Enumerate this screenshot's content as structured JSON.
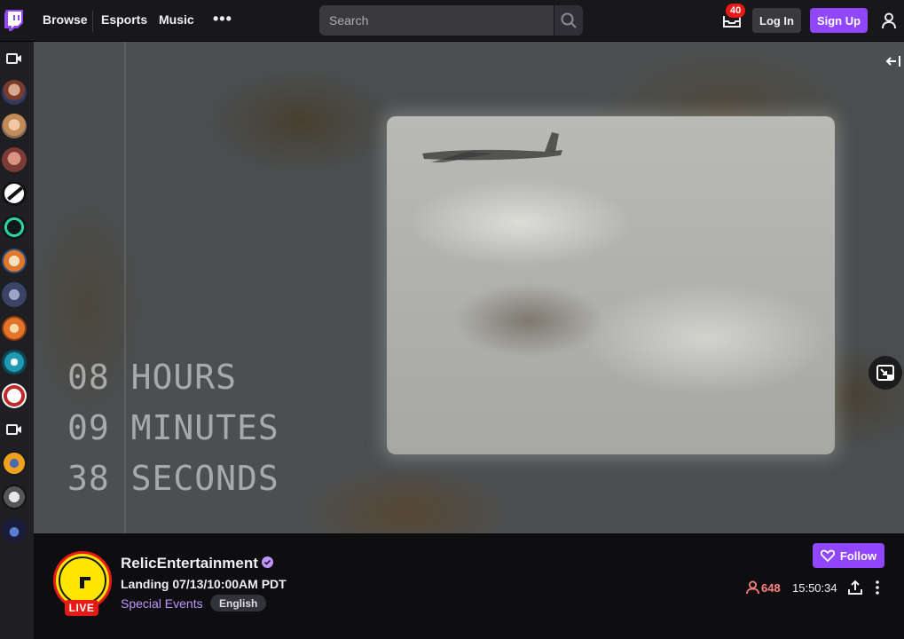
{
  "nav": {
    "links": [
      "Browse",
      "Esports",
      "Music"
    ],
    "more": "•••",
    "search_placeholder": "Search",
    "notification_count": "40",
    "login_label": "Log In",
    "signup_label": "Sign Up"
  },
  "player": {
    "countdown": [
      "08 HOURS",
      "09 MINUTES",
      "38 SECONDS"
    ]
  },
  "channel": {
    "name": "RelicEntertainment",
    "live_label": "LIVE",
    "stream_title": "Landing 07/13/10:00AM PDT",
    "category": "Special Events",
    "tag": "English",
    "follow_label": "Follow",
    "viewers": "648",
    "uptime": "15:50:34"
  },
  "colors": {
    "brand": "#9147ff",
    "live": "#e91916",
    "viewers": "#ff8280",
    "category": "#bf94ff"
  }
}
